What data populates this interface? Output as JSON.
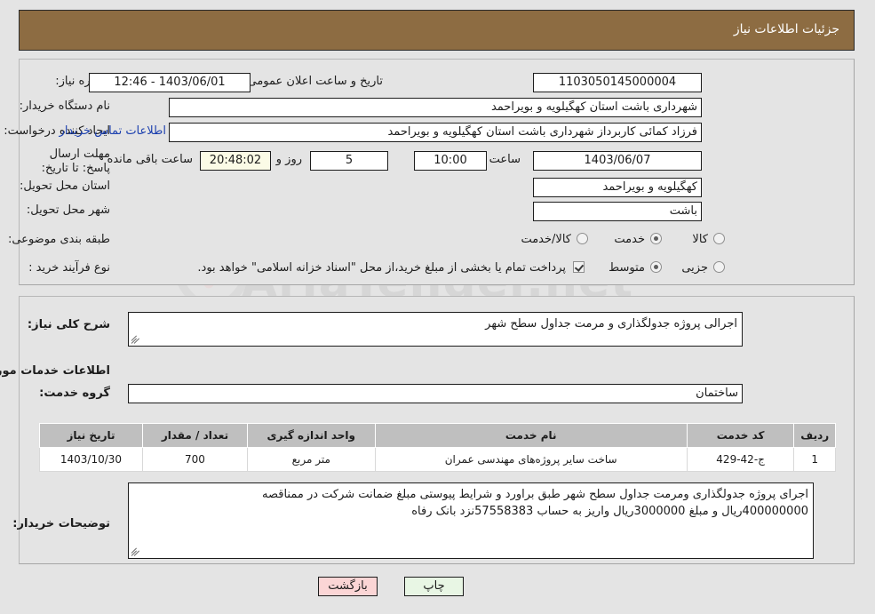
{
  "header": {
    "title": "جزئیات اطلاعات نیاز"
  },
  "watermark": {
    "text": "AriaTender.net",
    "shield_icon": "shield-icon"
  },
  "top_section": {
    "fields": {
      "need_number": {
        "label": "شماره نیاز:",
        "value": "1103050145000004"
      },
      "announce_datetime": {
        "label": "تاریخ و ساعت اعلان عمومی:",
        "value": "1403/06/01 - 12:46"
      },
      "buyer_org": {
        "label": "نام دستگاه خریدار:",
        "value": "شهرداری باشت استان کهگیلویه و بویراحمد"
      },
      "requester": {
        "label": "ایجاد کننده درخواست:",
        "value": "فرزاد کمائی کاربرداز شهرداری باشت استان کهگیلویه و بویراحمد"
      },
      "contact_link": {
        "label": "اطلاعات تماس خریدار"
      },
      "deadline": {
        "label": "مهلت ارسال پاسخ: تا تاریخ:",
        "date": "1403/06/07",
        "time_label": "ساعت",
        "time": "10:00",
        "days": "5",
        "days_label": "روز و",
        "countdown": "20:48:02",
        "countdown_label": "ساعت باقی مانده"
      },
      "delivery_province": {
        "label": "استان محل تحویل:",
        "value": "کهگیلویه و بویراحمد"
      },
      "delivery_city": {
        "label": "شهر محل تحویل:",
        "value": "باشت"
      },
      "category": {
        "label": "طبقه بندی موضوعی:",
        "options": [
          {
            "label": "کالا",
            "selected": false
          },
          {
            "label": "خدمت",
            "selected": true
          },
          {
            "label": "کالا/خدمت",
            "selected": false
          }
        ]
      },
      "purchase_type": {
        "label": "نوع فرآیند خرید :",
        "options": [
          {
            "label": "جزیی",
            "selected": false
          },
          {
            "label": "متوسط",
            "selected": true
          }
        ],
        "treasury_checkbox": {
          "checked": true,
          "label": "پرداخت تمام یا بخشی از مبلغ خرید،از محل \"اسناد خزانه اسلامی\" خواهد بود."
        }
      }
    }
  },
  "bottom_section": {
    "general_description": {
      "label": "شرح کلی نیاز:",
      "value": "اجرالی پروژه جدولگذاری و مرمت جداول سطح شهر"
    },
    "services_heading": "اطلاعات خدمات مورد نیاز",
    "service_group": {
      "label": "گروه خدمت:",
      "value": "ساختمان"
    },
    "table": {
      "headers": [
        "ردیف",
        "کد خدمت",
        "نام خدمت",
        "واحد اندازه گیری",
        "تعداد / مقدار",
        "تاریخ نیاز"
      ],
      "rows": [
        {
          "row_no": "1",
          "service_code": "ج-42-429",
          "service_name": "ساخت سایر پروژه‌های مهندسی عمران",
          "unit": "متر مربع",
          "quantity": "700",
          "need_date": "1403/10/30"
        }
      ]
    },
    "buyer_notes": {
      "label": "توضیحات خریدار:",
      "line1": "اجرای پروژه جدولگذاری ومرمت جداول سطح شهر  طبق براورد و شرایط پیوستی مبلغ ضمانت شرکت در ممناقصه",
      "line2": "400000000ریال و مبلغ 3000000ریال واریز به حساب 57558383نزد بانک رفاه"
    }
  },
  "footer": {
    "print_label": "چاپ",
    "back_label": "بازگشت"
  },
  "colors": {
    "header_bar": "#8d6c42",
    "page_bg": "#e4e4e4",
    "table_header": "#bfbfbf",
    "link": "#1b3fae",
    "countdown_bg": "#fbfbe6",
    "print_btn": "#e8f6e4",
    "back_btn": "#fbd5d5"
  }
}
